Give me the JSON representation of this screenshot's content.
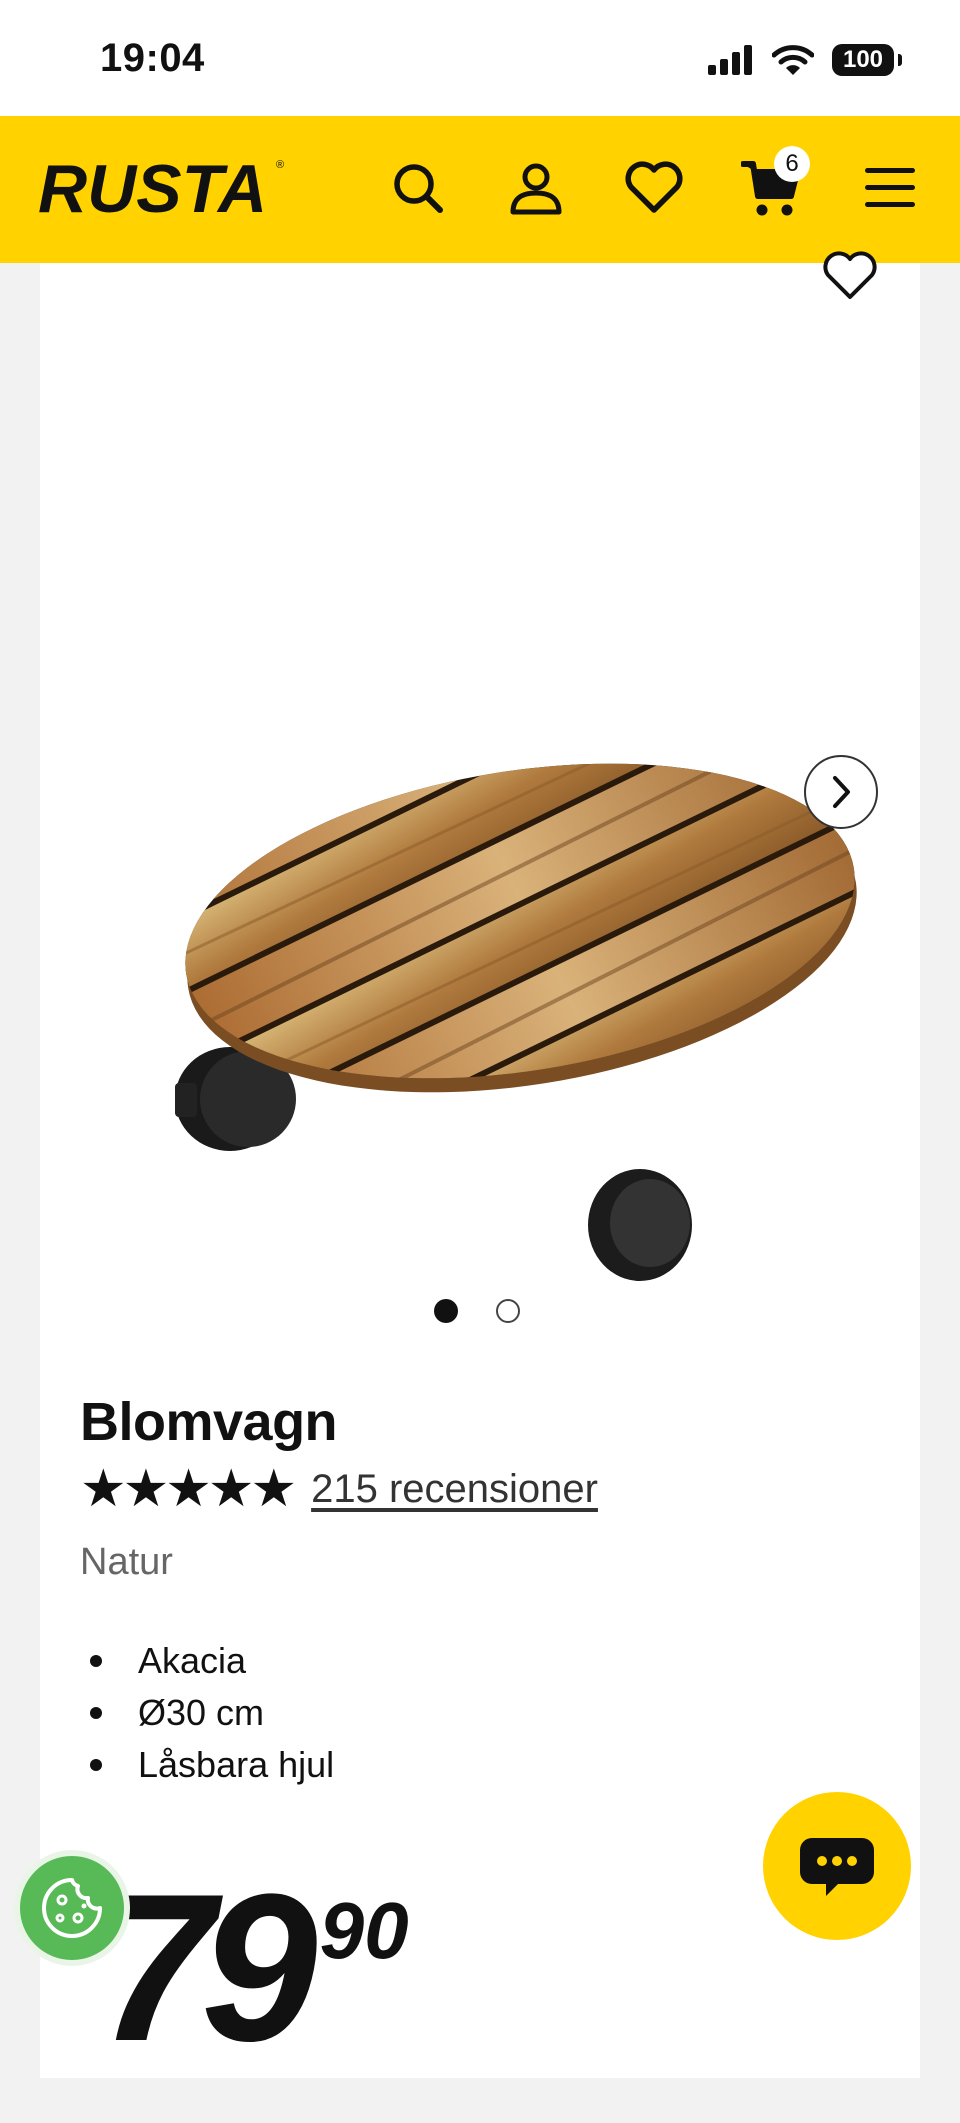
{
  "status_bar": {
    "time": "19:04",
    "battery": "100",
    "icons": [
      "signal-icon",
      "wifi-icon",
      "battery-icon"
    ]
  },
  "header": {
    "logo_text": "RUSTA",
    "cart_count": "6",
    "icons": [
      "search-icon",
      "user-icon",
      "heart-icon",
      "cart-icon",
      "menu-icon"
    ],
    "brand_color": "#ffd200"
  },
  "product": {
    "title": "Blomvagn",
    "stars": "★★★★★",
    "rating_value": 5,
    "reviews_label": "215 recensioner",
    "variant": "Natur",
    "features": [
      "Akacia",
      "Ø30 cm",
      "Låsbara hjul"
    ],
    "price_main": "79",
    "price_decimals": "90",
    "gallery": {
      "image_count": 2,
      "active_index": 0
    }
  },
  "floating": {
    "chat_icon": "chat-icon",
    "cookie_icon": "cookie-icon"
  }
}
